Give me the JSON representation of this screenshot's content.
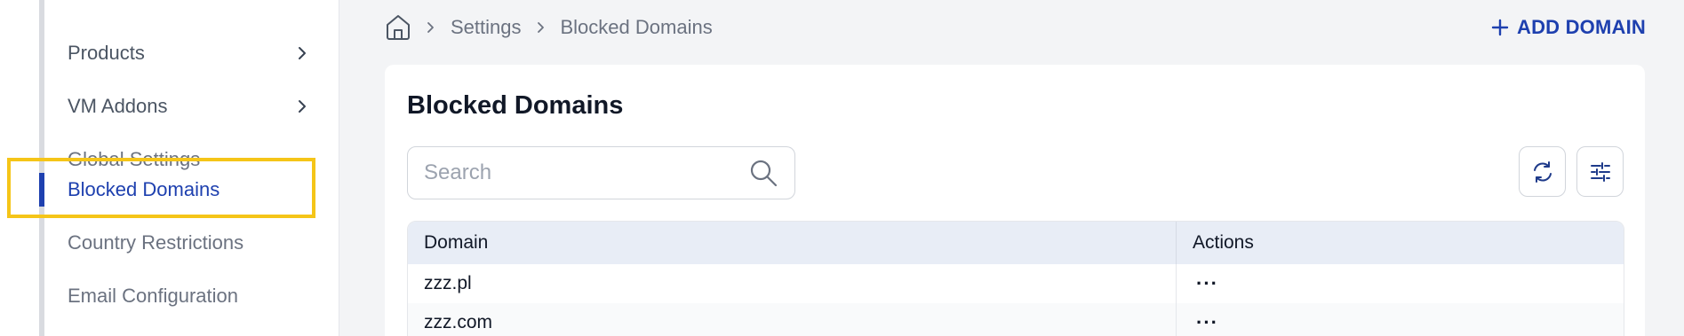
{
  "sidebar": {
    "items": [
      {
        "label": "Products",
        "has_chevron": true
      },
      {
        "label": "VM Addons",
        "has_chevron": true
      },
      {
        "label": "Global Settings",
        "has_chevron": false
      },
      {
        "label": "Blocked Domains",
        "has_chevron": false,
        "active": true
      },
      {
        "label": "Country Restrictions",
        "has_chevron": false
      },
      {
        "label": "Email Configuration",
        "has_chevron": false
      }
    ]
  },
  "breadcrumb": {
    "home_icon": "home-icon",
    "items": [
      "Settings",
      "Blocked Domains"
    ]
  },
  "header": {
    "add_domain_label": "ADD DOMAIN"
  },
  "card": {
    "title": "Blocked Domains",
    "search": {
      "placeholder": "Search",
      "value": ""
    },
    "table": {
      "columns": [
        "Domain",
        "Actions"
      ],
      "rows": [
        {
          "domain": "zzz.pl",
          "actions": "···"
        },
        {
          "domain": "zzz.com",
          "actions": "···"
        }
      ]
    }
  },
  "colors": {
    "accent": "#1e40af",
    "highlight": "#f5c518"
  }
}
